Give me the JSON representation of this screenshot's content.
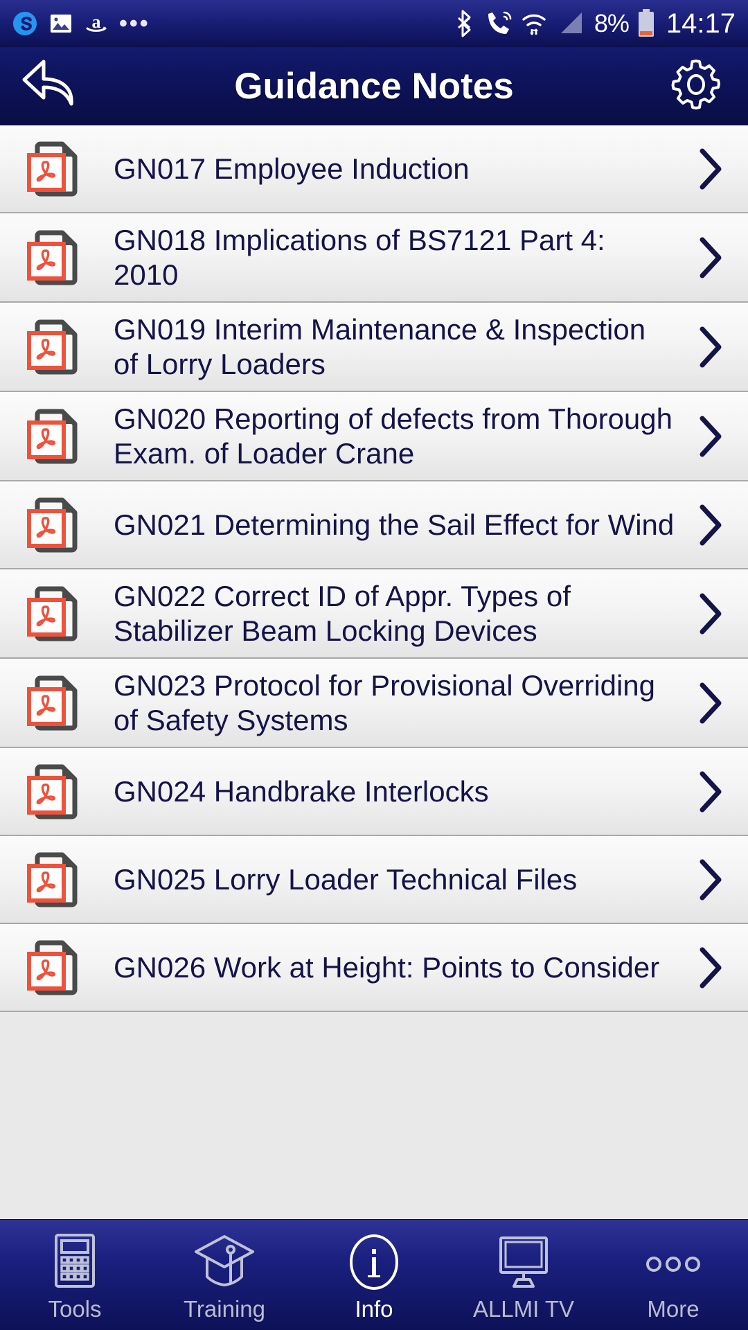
{
  "status_bar": {
    "left_icons": [
      "skype-icon",
      "gallery-icon",
      "amazon-icon",
      "more-notifications-icon"
    ],
    "overflow_dots": "•••",
    "right_icons": [
      "bluetooth-icon",
      "call-icon",
      "wifi-icon",
      "signal-icon"
    ],
    "battery_percent": "8%",
    "time": "14:17"
  },
  "header": {
    "back_icon": "back-arrow-icon",
    "title": "Guidance Notes",
    "settings_icon": "gear-icon"
  },
  "list": {
    "item_icon": "pdf-file-icon",
    "chevron_icon": "chevron-right-icon",
    "items": [
      {
        "title": "GN017 Employee Induction"
      },
      {
        "title": "GN018 Implications of BS7121 Part 4: 2010"
      },
      {
        "title": "GN019 Interim Maintenance & Inspection of Lorry Loaders"
      },
      {
        "title": "GN020 Reporting of defects from Thorough Exam. of Loader Crane"
      },
      {
        "title": "GN021 Determining the Sail Effect for Wind"
      },
      {
        "title": "GN022 Correct ID of Appr. Types of Stabilizer Beam Locking Devices"
      },
      {
        "title": "GN023 Protocol for Provisional Overriding of Safety Systems"
      },
      {
        "title": "GN024 Handbrake Interlocks"
      },
      {
        "title": "GN025 Lorry Loader Technical Files"
      },
      {
        "title": "GN026 Work at Height: Points to Consider"
      }
    ]
  },
  "tabbar": {
    "tabs": [
      {
        "label": "Tools",
        "icon": "calculator-icon",
        "active": false
      },
      {
        "label": "Training",
        "icon": "graduation-cap-icon",
        "active": false
      },
      {
        "label": "Info",
        "icon": "info-circle-icon",
        "active": true
      },
      {
        "label": "ALLMI TV",
        "icon": "monitor-icon",
        "active": false
      },
      {
        "label": "More",
        "icon": "ellipsis-icon",
        "active": false
      }
    ]
  },
  "colors": {
    "status_bar_blue": "#191e78",
    "header_navy": "#0d1259",
    "tabbar_blue": "#1b2080",
    "list_text_navy": "#141449",
    "pdf_red": "#f05a45",
    "pdf_grey": "#4a4a4a",
    "row_bg": "#f4f4f4",
    "tab_inactive": "#b9bcd0",
    "tab_active": "#ffffff"
  }
}
